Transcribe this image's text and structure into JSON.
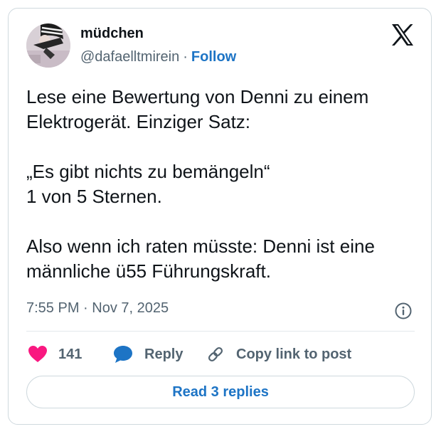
{
  "author": {
    "display_name": "müdchen",
    "handle": "@dafaelltmirein",
    "separator": "·",
    "follow_label": "Follow",
    "avatar_icon": "profile-photo-icon"
  },
  "platform_icon": "x-logo-icon",
  "tweet": {
    "text": "Lese eine Bewertung von Denni zu einem Elektrogerät. Einziger Satz:\n\n„Es gibt nichts zu bemängeln“\n1 von 5 Sternen.\n\nAlso wenn ich raten müsste: Denni ist eine männliche ü55 Führungskraft.",
    "timestamp": "7:55 PM · Nov 7, 2025",
    "info_icon": "info-icon"
  },
  "actions": {
    "like_count": "141",
    "reply_label": "Reply",
    "copy_link_label": "Copy link to post",
    "like_icon": "heart-icon",
    "reply_icon": "speech-bubble-icon",
    "copy_icon": "link-icon"
  },
  "read_replies_label": "Read 3 replies",
  "colors": {
    "accent": "#1d74c5",
    "like": "#f91880",
    "text": "#0f1419",
    "secondary_text": "#536471",
    "border": "#cfd9de"
  }
}
